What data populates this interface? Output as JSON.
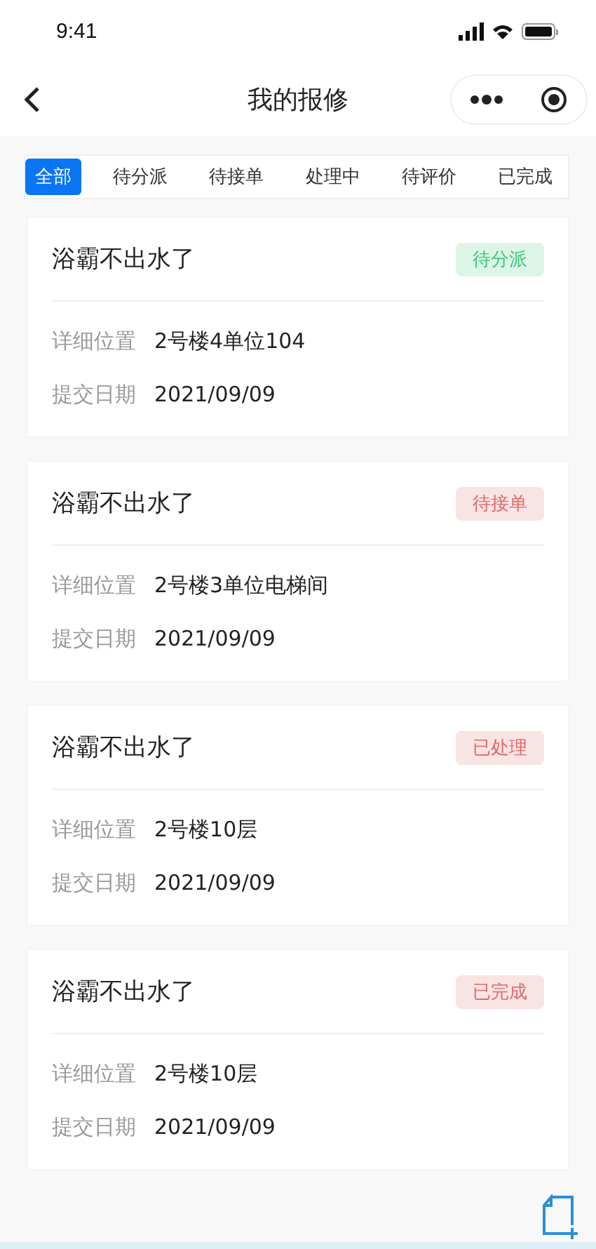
{
  "status_bar": {
    "time": "9:41"
  },
  "nav": {
    "title": "我的报修"
  },
  "tabs": [
    {
      "label": "全部",
      "selected": true
    },
    {
      "label": "待分派",
      "selected": false
    },
    {
      "label": "待接单",
      "selected": false
    },
    {
      "label": "处理中",
      "selected": false
    },
    {
      "label": "待评价",
      "selected": false
    },
    {
      "label": "已完成",
      "selected": false
    }
  ],
  "orders": [
    {
      "title": "浴霸不出水了",
      "status": "待分派",
      "color": "#3cc77a",
      "fields": [
        {
          "label": "详细位置",
          "value": "2号楼4单位104"
        },
        {
          "label": "提交日期",
          "value": "2021/09/09"
        }
      ]
    },
    {
      "title": "浴霸不出水了",
      "status": "待接单",
      "color": "#e06a6a",
      "fields": [
        {
          "label": "详细位置",
          "value": "2号楼3单位电梯间"
        },
        {
          "label": "提交日期",
          "value": "2021/09/09"
        }
      ]
    },
    {
      "title": "浴霸不出水了",
      "status": "已处理",
      "color": "#e06a6a",
      "fields": [
        {
          "label": "详细位置",
          "value": "2号楼10层"
        },
        {
          "label": "提交日期",
          "value": "2021/09/09"
        }
      ]
    },
    {
      "title": "浴霸不出水了",
      "status": "已完成",
      "color": "#e06a6a",
      "fields": [
        {
          "label": "详细位置",
          "value": "2号楼10层"
        },
        {
          "label": "提交日期",
          "value": "2021/09/09"
        }
      ]
    }
  ]
}
